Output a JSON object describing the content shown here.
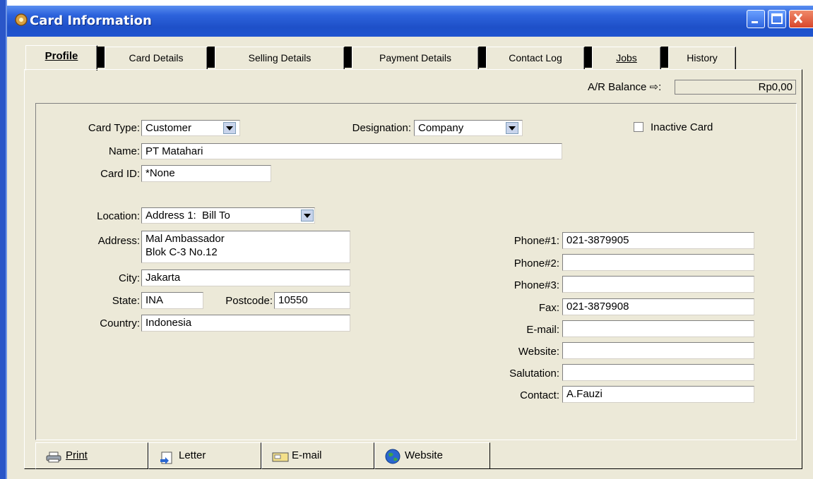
{
  "window": {
    "title": "Card Information"
  },
  "tabs": [
    {
      "label": "Profile",
      "active": true
    },
    {
      "label": "Card Details",
      "active": false
    },
    {
      "label": "Selling Details",
      "active": false
    },
    {
      "label": "Payment Details",
      "active": false
    },
    {
      "label": "Contact Log",
      "active": false
    },
    {
      "label": "Jobs",
      "active": false
    },
    {
      "label": "History",
      "active": false
    }
  ],
  "balance": {
    "label": "A/R Balance ⇨:",
    "value": "Rp0,00"
  },
  "profile": {
    "card_type_label": "Card Type:",
    "card_type_value": "Customer",
    "designation_label": "Designation:",
    "designation_value": "Company",
    "inactive_label": "Inactive Card",
    "name_label": "Name:",
    "name_value": "PT Matahari",
    "card_id_label": "Card ID:",
    "card_id_value": "*None"
  },
  "address": {
    "location_label": "Location:",
    "location_value": "Address 1:  Bill To",
    "address_label": "Address:",
    "address_value": "Mal Ambassador\nBlok C-3 No.12",
    "city_label": "City:",
    "city_value": "Jakarta",
    "state_label": "State:",
    "state_value": "INA",
    "postcode_label": "Postcode:",
    "postcode_value": "10550",
    "country_label": "Country:",
    "country_value": "Indonesia"
  },
  "contact": {
    "phone1_label": "Phone#1:",
    "phone1_value": "021-3879905",
    "phone2_label": "Phone#2:",
    "phone2_value": "",
    "phone3_label": "Phone#3:",
    "phone3_value": "",
    "fax_label": "Fax:",
    "fax_value": "021-3879908",
    "email_label": "E-mail:",
    "email_value": "",
    "website_label": "Website:",
    "website_value": "",
    "salutation_label": "Salutation:",
    "salutation_value": "",
    "contact_label": "Contact:",
    "contact_value": "A.Fauzi"
  },
  "buttons": {
    "print": "Print",
    "letter": "Letter",
    "email": "E-mail",
    "website": "Website"
  },
  "colors": {
    "titlebar": "#1f54d0",
    "face": "#ece9d8"
  }
}
